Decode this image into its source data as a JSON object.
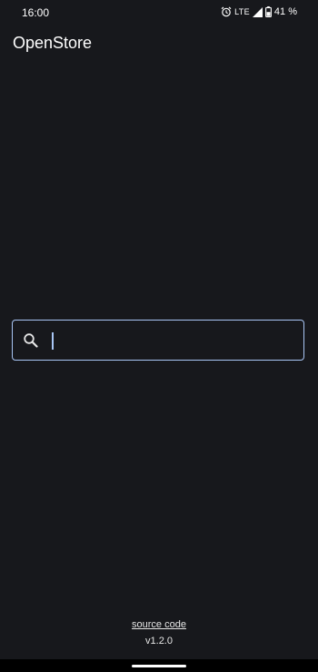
{
  "status_bar": {
    "time": "16:00",
    "network": "LTE",
    "battery_percent": "41 %",
    "icons": [
      "alarm-icon",
      "signal-icon",
      "battery-icon"
    ]
  },
  "app": {
    "title": "OpenStore"
  },
  "search": {
    "value": "",
    "placeholder": "",
    "icon": "search-icon"
  },
  "footer": {
    "source_link": "source code",
    "version": "v1.2.0"
  },
  "colors": {
    "background": "#17181c",
    "accent": "#a9c6f5",
    "text": "#e6e6e6"
  }
}
